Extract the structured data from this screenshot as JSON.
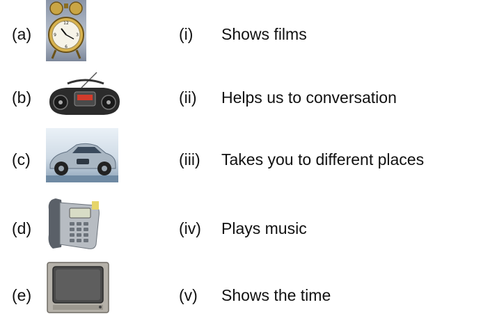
{
  "items": [
    {
      "label": "(a)",
      "picture": "alarm-clock"
    },
    {
      "label": "(b)",
      "picture": "radio"
    },
    {
      "label": "(c)",
      "picture": "car"
    },
    {
      "label": "(d)",
      "picture": "telephone"
    },
    {
      "label": "(e)",
      "picture": "television"
    }
  ],
  "uses": [
    {
      "numeral": "(i)",
      "text": "Shows films"
    },
    {
      "numeral": "(ii)",
      "text": "Helps us to conversation"
    },
    {
      "numeral": "(iii)",
      "text": "Takes you to different places"
    },
    {
      "numeral": "(iv)",
      "text": "Plays music"
    },
    {
      "numeral": "(v)",
      "text": "Shows the time"
    }
  ]
}
